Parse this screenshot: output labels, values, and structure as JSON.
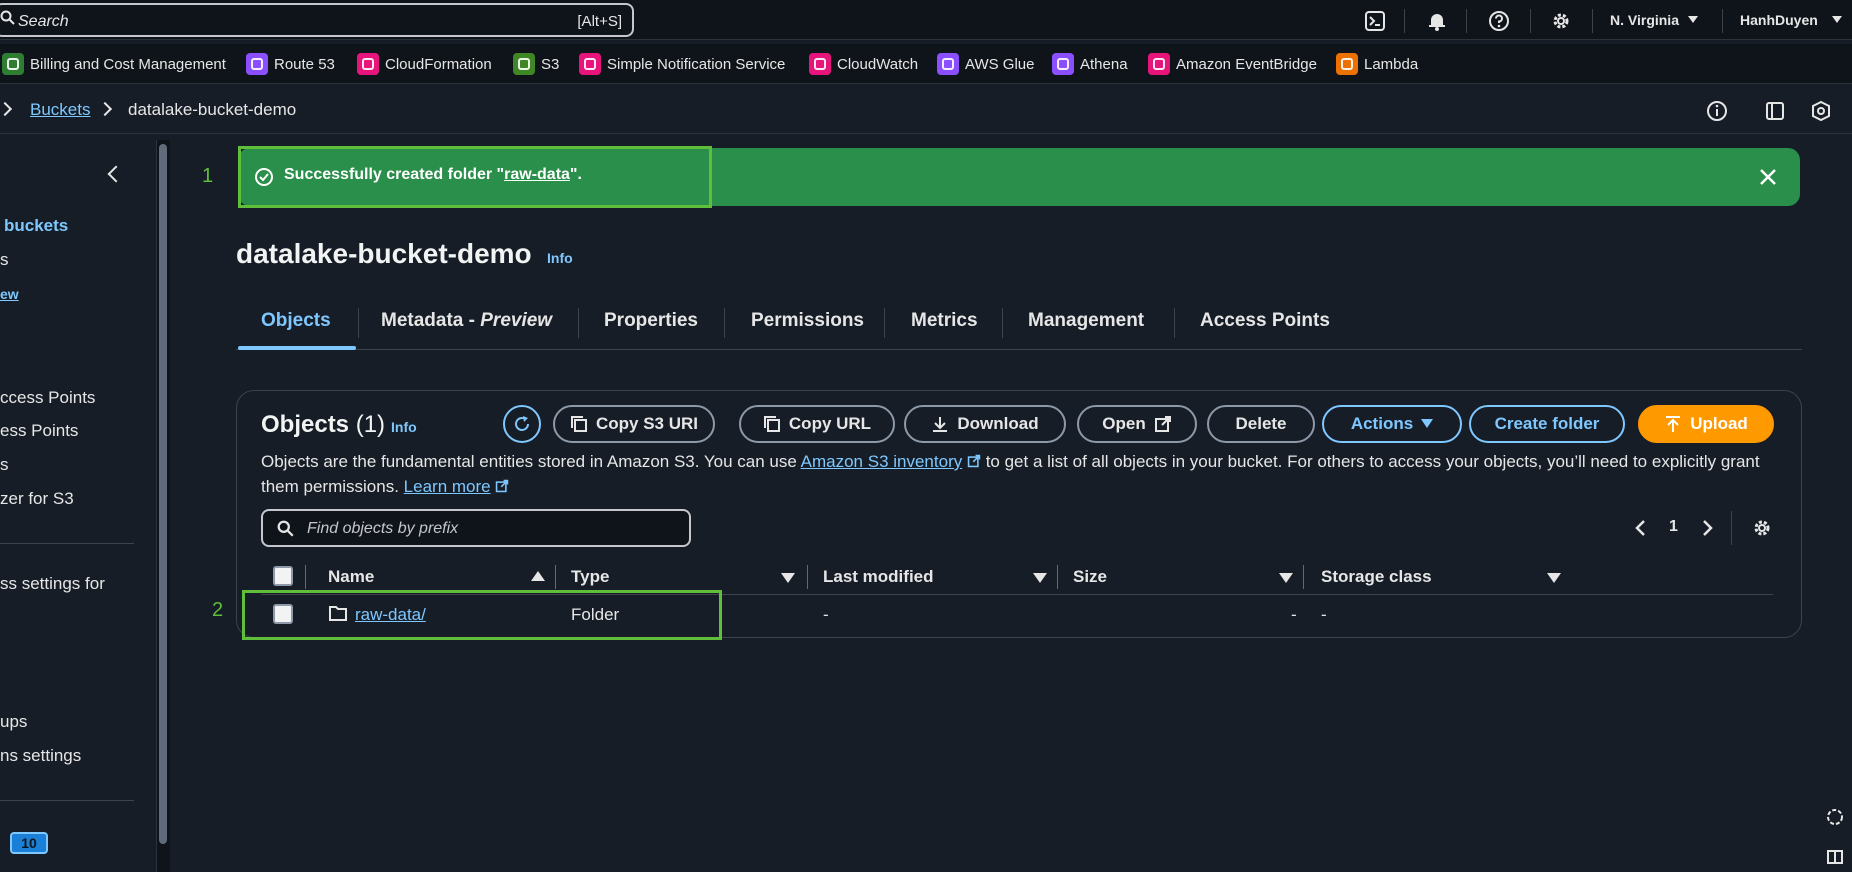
{
  "topbar": {
    "search_placeholder": "Search",
    "search_shortcut": "[Alt+S]",
    "region": "N. Virginia",
    "user": "HanhDuyen"
  },
  "favorites": [
    {
      "label": "Billing and Cost Management",
      "color": "#2e7d32"
    },
    {
      "label": "Route 53",
      "color": "#8c4fff"
    },
    {
      "label": "CloudFormation",
      "color": "#e7157b"
    },
    {
      "label": "S3",
      "color": "#3f8624"
    },
    {
      "label": "Simple Notification Service",
      "color": "#e7157b"
    },
    {
      "label": "CloudWatch",
      "color": "#e7157b"
    },
    {
      "label": "AWS Glue",
      "color": "#8c4fff"
    },
    {
      "label": "Athena",
      "color": "#8c4fff"
    },
    {
      "label": "Amazon EventBridge",
      "color": "#e7157b"
    },
    {
      "label": "Lambda",
      "color": "#ed7100"
    }
  ],
  "breadcrumb": {
    "parent": "Buckets",
    "current": "datalake-bucket-demo"
  },
  "sidebar": {
    "items": [
      {
        "label": "buckets"
      },
      {
        "label": "s"
      },
      {
        "label": "ew"
      },
      {
        "label": "ccess Points"
      },
      {
        "label": "ess Points"
      },
      {
        "label": "s"
      },
      {
        "label": "zer for S3"
      },
      {
        "label": "ss settings for"
      },
      {
        "label": "ups"
      },
      {
        "label": "ns settings"
      }
    ],
    "badge": "10"
  },
  "flash": {
    "message_prefix": "Successfully created folder \"",
    "folder_link": "raw-data",
    "message_suffix": "\".",
    "accent": "#2a8f4a"
  },
  "annotations": {
    "step1": "1",
    "step2": "2",
    "highlight_color": "#5fbf3a"
  },
  "bucket": {
    "name": "datalake-bucket-demo",
    "info": "Info"
  },
  "tabs": [
    {
      "label": "Objects"
    },
    {
      "label": "Metadata - ",
      "italic": "Preview"
    },
    {
      "label": "Properties"
    },
    {
      "label": "Permissions"
    },
    {
      "label": "Metrics"
    },
    {
      "label": "Management"
    },
    {
      "label": "Access Points"
    }
  ],
  "objects": {
    "title": "Objects",
    "count": "(1)",
    "info": "Info",
    "buttons": {
      "copy_uri": "Copy S3 URI",
      "copy_url": "Copy URL",
      "download": "Download",
      "open": "Open",
      "delete": "Delete",
      "actions": "Actions",
      "create_folder": "Create folder",
      "upload": "Upload"
    },
    "description_1": "Objects are the fundamental entities stored in Amazon S3. You can use ",
    "inventory_link": "Amazon S3 inventory",
    "description_2": " to get a list of all objects in your bucket. For others to access your objects, you’ll need to explicitly grant them permissions. ",
    "learn_more": "Learn more",
    "search_placeholder": "Find objects by prefix",
    "page": "1",
    "columns": {
      "name": "Name",
      "type": "Type",
      "last_modified": "Last modified",
      "size": "Size",
      "storage_class": "Storage class"
    },
    "rows": [
      {
        "name": "raw-data/",
        "type": "Folder",
        "last_modified": "-",
        "size": "-",
        "storage_class": "-"
      }
    ]
  }
}
